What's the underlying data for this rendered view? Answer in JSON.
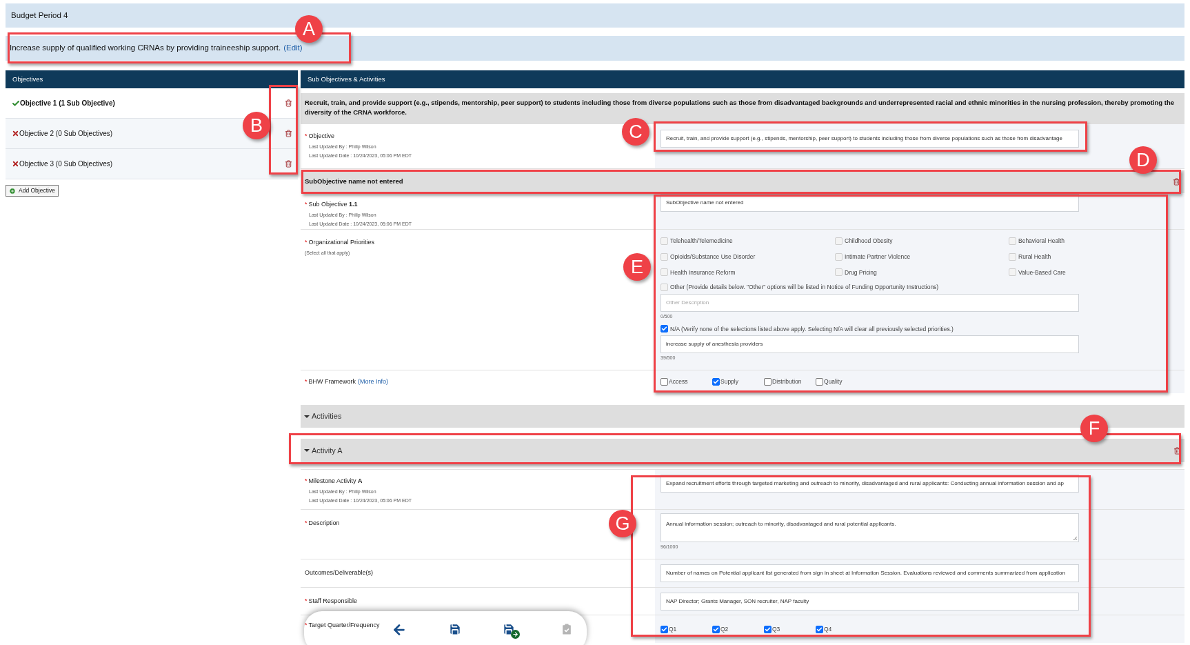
{
  "budget_period": {
    "title": "Budget Period 4"
  },
  "goal": {
    "text": "Increase supply of qualified working CRNAs by providing traineeship support.",
    "edit_link": "(Edit)"
  },
  "objectives_panel": {
    "header": "Objectives",
    "add_button": "Add Objective",
    "items": [
      {
        "label": "Objective 1 (1 Sub Objective)",
        "complete": true,
        "selected": true
      },
      {
        "label": "Objective 2 (0 Sub Objectives)",
        "complete": false,
        "selected": false
      },
      {
        "label": "Objective 3 (0 Sub Objectives)",
        "complete": false,
        "selected": false
      }
    ]
  },
  "sub_panel": {
    "header": "Sub Objectives & Activities",
    "objective_description": "Recruit, train, and provide support (e.g., stipends, mentorship, peer support) to students including those from diverse populations such as those from disadvantaged backgrounds and underrepresented racial and ethnic minorities in the nursing profession, thereby promoting the diversity of the CRNA workforce.",
    "objective": {
      "label": "Objective",
      "required_mark": "*",
      "updated_by": "Last Updated By : Philip Wilson",
      "updated_date": "Last Updated Date : 10/24/2023, 05:06 PM EDT",
      "value": "Recruit, train, and provide support (e.g., stipends, mentorship, peer support) to students including those from diverse populations such as those from disadvantage"
    },
    "subobjective": {
      "title": "SubObjective name not entered",
      "name_label": "Sub Objective **1.1**",
      "required_mark": "*",
      "updated_by": "Last Updated By : Philip Wilson",
      "updated_date": "Last Updated Date : 10/24/2023, 05:06 PM EDT",
      "name_value": "SubObjective name not entered",
      "priorities_label": "Organizational Priorities",
      "priorities_hint": "(Select all that apply)",
      "priorities": [
        {
          "label": "Telehealth/Telemedicine",
          "checked": false
        },
        {
          "label": "Childhood Obesity",
          "checked": false
        },
        {
          "label": "Behavioral Health",
          "checked": false
        },
        {
          "label": "Opioids/Substance Use Disorder",
          "checked": false
        },
        {
          "label": "Intimate Partner Violence",
          "checked": false
        },
        {
          "label": "Rural Health",
          "checked": false
        },
        {
          "label": "Health Insurance Reform",
          "checked": false
        },
        {
          "label": "Drug Pricing",
          "checked": false
        },
        {
          "label": "Value-Based Care",
          "checked": false
        }
      ],
      "other": {
        "label": "Other (Provide details below. \"Other\" options will be listed in Notice of Funding Opportunity Instructions)",
        "checked": false,
        "placeholder": "Other Description",
        "counter": "0/500"
      },
      "na": {
        "label": "N/A (Verify none of the selections listed above apply. Selecting N/A will clear all previously selected priorities.)",
        "checked": true,
        "value": "increase supply of anesthesia providers",
        "counter": "39/500"
      },
      "framework_label": "BHW Framework",
      "framework_link": "(More Info)",
      "framework": [
        {
          "label": "Access",
          "checked": false
        },
        {
          "label": "Supply",
          "checked": true
        },
        {
          "label": "Distribution",
          "checked": false
        },
        {
          "label": "Quality",
          "checked": false
        }
      ]
    },
    "activities": {
      "title": "Activities",
      "expanded": true
    },
    "activity": {
      "title": "Activity A",
      "expanded": true,
      "required_mark": "*",
      "milestone_label": "Milestone Activity **A**",
      "updated_by": "Last Updated By : Philip Wilson",
      "updated_date": "Last Updated Date : 10/24/2023, 05:06 PM EDT",
      "milestone_value": "Expand recruitment efforts through targeted marketing and outreach to minority, disadvantaged and rural applicants: Conducting annual information session and ap",
      "description_label": "Description",
      "description_value": "Annual information session; outreach to minority, disadvantaged and rural potential applicants.",
      "description_counter": "96/1000",
      "outcomes_label": "Outcomes/Deliverable(s)",
      "outcomes_value": "Number of names on Potential applicant list generated from sign in sheet at Information Session. Evaluations reviewed and comments summarized from application",
      "staff_label": "Staff Responsible",
      "staff_value": "NAP Director; Grants Manager, SON recruiter, NAP faculty",
      "target_label": "Target Quarter/Frequency",
      "quarters": [
        {
          "label": "Q1",
          "checked": true
        },
        {
          "label": "Q2",
          "checked": true
        },
        {
          "label": "Q3",
          "checked": true
        },
        {
          "label": "Q4",
          "checked": true
        }
      ]
    }
  },
  "toolbar": [
    {
      "kind": "back",
      "disabled": false
    },
    {
      "kind": "save",
      "disabled": false
    },
    {
      "kind": "save-next",
      "disabled": false
    },
    {
      "kind": "submit",
      "disabled": true
    }
  ],
  "annotations": [
    {
      "letter": "A"
    },
    {
      "letter": "B"
    },
    {
      "letter": "C"
    },
    {
      "letter": "D"
    },
    {
      "letter": "E"
    },
    {
      "letter": "F"
    },
    {
      "letter": "G"
    }
  ]
}
